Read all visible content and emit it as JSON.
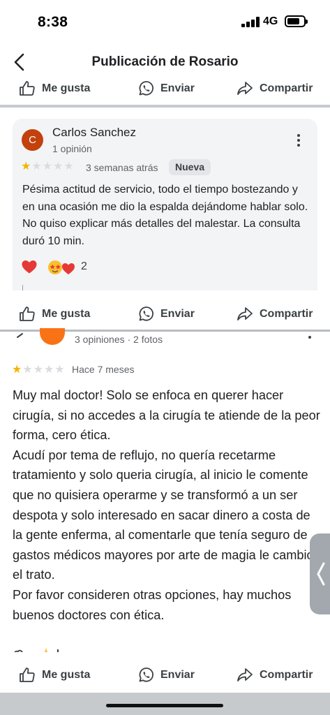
{
  "status_bar": {
    "time": "8:38",
    "network": "4G",
    "icons": [
      "signal-icon",
      "battery-icon"
    ]
  },
  "header": {
    "title": "Publicación de Rosario",
    "back_icon": "chevron-left-icon"
  },
  "actions": {
    "like": "Me gusta",
    "send": "Enviar",
    "share": "Compartir",
    "icons": [
      "thumbs-up-icon",
      "whatsapp-icon",
      "share-arrow-icon"
    ]
  },
  "review1": {
    "avatar_letter": "C",
    "avatar_color": "#c2410c",
    "name": "Carlos Sanchez",
    "meta": "1 opinión",
    "rating": 1,
    "rating_max": 5,
    "date": "3 semanas atrás",
    "badge": "Nueva",
    "text": "Pésima actitud de servicio, todo el tiempo bostezando y en una ocasión me dio la espalda dejándome hablar solo. No quiso explicar más detalles del malestar. La consulta duró 10 min.",
    "reaction_count": "2",
    "reaction_icons": [
      "heart-icon",
      "star-struck-emoji-icon",
      "heart-icon"
    ]
  },
  "review2": {
    "avatar_color": "#f97316",
    "meta": "3 opiniones · 2 fotos",
    "rating": 1,
    "rating_max": 5,
    "date": "Hace 7 meses",
    "paragraphs": [
      "Muy mal doctor! Solo se enfoca en querer hacer cirugía, si no accedes a la cirugía te atiende de la peor forma, cero ética.",
      "Acudí por tema de reflujo, no quería recetarme tratamiento y solo queria cirugía, al inicio le comente que no quisiera operarme y se transformó a un ser despota y solo interesado en sacar dinero a costa de la gente enferma, al comentarle que tenía seguro de gastos médicos mayores por arte de magia le cambio el trato.",
      "Por favor consideren otras opciones, hay muchos buenos doctores con ética."
    ]
  },
  "colors": {
    "star_on": "#f4b400",
    "star_off": "#dadce0",
    "heart": "#e53935"
  }
}
